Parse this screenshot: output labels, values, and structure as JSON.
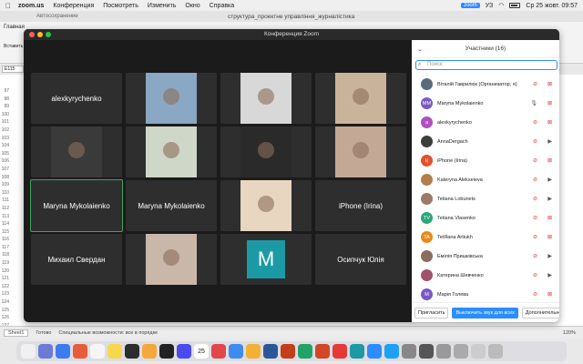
{
  "menubar": {
    "app": "zoom.us",
    "items": [
      "Конференция",
      "Посмотреть",
      "Изменить",
      "Окно",
      "Справка"
    ],
    "right": {
      "zoom_badge": "zoom",
      "input": "УЗ",
      "clock": "Ср 25 жовт. 09:57"
    }
  },
  "excel": {
    "autosave": "Автосохранение",
    "doc_title": "структура_проектне управління_журналістика",
    "tab": "Главная",
    "insert": "Вставить",
    "namebox": "E115",
    "rows": [
      "97",
      "98",
      "99",
      "100",
      "101",
      "102",
      "103",
      "104",
      "105",
      "106",
      "107",
      "108",
      "109",
      "110",
      "111",
      "112",
      "113",
      "114",
      "115",
      "116",
      "117",
      "118",
      "119",
      "120",
      "121",
      "122",
      "123",
      "124",
      "125",
      "126",
      "127"
    ],
    "status": {
      "sheet": "Sheet1",
      "ready": "Готово",
      "accessibility": "Специальные возможности: все в порядке",
      "zoom": "120%"
    }
  },
  "zoom": {
    "window_title": "Конференция Zoom",
    "tiles": [
      {
        "name": "alexkyrychenko",
        "kind": "name"
      },
      {
        "name": "",
        "kind": "video",
        "color": "#8aa7c3"
      },
      {
        "name": "",
        "kind": "video",
        "color": "#d8d8d8"
      },
      {
        "name": "",
        "kind": "video",
        "color": "#c9b49b"
      },
      {
        "name": "",
        "kind": "video",
        "color": "#3a3a3a"
      },
      {
        "name": "",
        "kind": "video",
        "color": "#cfd8c8"
      },
      {
        "name": "",
        "kind": "video",
        "color": "#2a2a2a"
      },
      {
        "name": "",
        "kind": "video",
        "color": "#c3a896"
      },
      {
        "name": "Maryna Mykolaienko",
        "kind": "name",
        "active": true
      },
      {
        "name": "Maryna Mykolaienko",
        "kind": "name"
      },
      {
        "name": "",
        "kind": "video",
        "color": "#e8d6c0"
      },
      {
        "name": "iPhone (Irina)",
        "kind": "name"
      },
      {
        "name": "Михаил Свердан",
        "kind": "name"
      },
      {
        "name": "",
        "kind": "video",
        "color": "#c9b7a9"
      },
      {
        "name": "M",
        "kind": "letter",
        "color": "#1b9aa6"
      },
      {
        "name": "Осипчук Юлія",
        "kind": "name"
      }
    ],
    "participants": {
      "title": "Участники (16)",
      "search_placeholder": "Поиск",
      "list": [
        {
          "initials": "",
          "name": "Віталій Гаврилюк (Организатор, я)",
          "color": "#5a6b7c",
          "mic": "muted",
          "cam": "off"
        },
        {
          "initials": "MM",
          "name": "Maryna Mykolaienko",
          "color": "#7b59c4",
          "mic": "on",
          "cam": "off"
        },
        {
          "initials": "a",
          "name": "alexkyrychenko",
          "color": "#b04fc2",
          "mic": "muted",
          "cam": "off"
        },
        {
          "initials": "",
          "name": "AnnaDergach",
          "color": "#3d3d3d",
          "mic": "muted",
          "cam": "on"
        },
        {
          "initials": "I(",
          "name": "iPhone (Irina)",
          "color": "#e2522c",
          "mic": "muted",
          "cam": "off"
        },
        {
          "initials": "",
          "name": "Kateryna Alekseieva",
          "color": "#b07f4a",
          "mic": "muted",
          "cam": "on"
        },
        {
          "initials": "",
          "name": "Tetiana Lobunets",
          "color": "#9b7b68",
          "mic": "muted",
          "cam": "on"
        },
        {
          "initials": "TV",
          "name": "Tetiana Vlasenko",
          "color": "#2ea67a",
          "mic": "muted",
          "cam": "off"
        },
        {
          "initials": "TA",
          "name": "TetЯana Artiukh",
          "color": "#e68a1c",
          "mic": "muted",
          "cam": "off"
        },
        {
          "initials": "",
          "name": "Емілія Пришківська",
          "color": "#8a6d5c",
          "mic": "muted",
          "cam": "on"
        },
        {
          "initials": "",
          "name": "Катерина Шевченко",
          "color": "#a0526b",
          "mic": "muted",
          "cam": "on"
        },
        {
          "initials": "M",
          "name": "Марія Голева",
          "color": "#7b59c4",
          "mic": "muted",
          "cam": "off"
        }
      ],
      "footer": {
        "invite": "Пригласить",
        "mute_all": "Выключить звук для всех",
        "more": "Дополнительно"
      }
    }
  },
  "dock": {
    "calendar_day": "25",
    "colors": [
      "#f0f0f0",
      "#6b7bd6",
      "#3d7bf0",
      "#e85c3a",
      "#f5f5f5",
      "#f7d84a",
      "#2d2d2d",
      "#f4a83b",
      "#222",
      "#4a4af0",
      "#2d8c5c",
      "#e2464a",
      "#3e8cf0",
      "#f2b134",
      "#2b579a",
      "#c43e1c",
      "#21a366",
      "#d24726",
      "#e53935",
      "#1b9aa6",
      "#2d8cff",
      "#1da1f2",
      "#888",
      "#555",
      "#999",
      "#aaa",
      "#ccc",
      "#bbb"
    ]
  }
}
